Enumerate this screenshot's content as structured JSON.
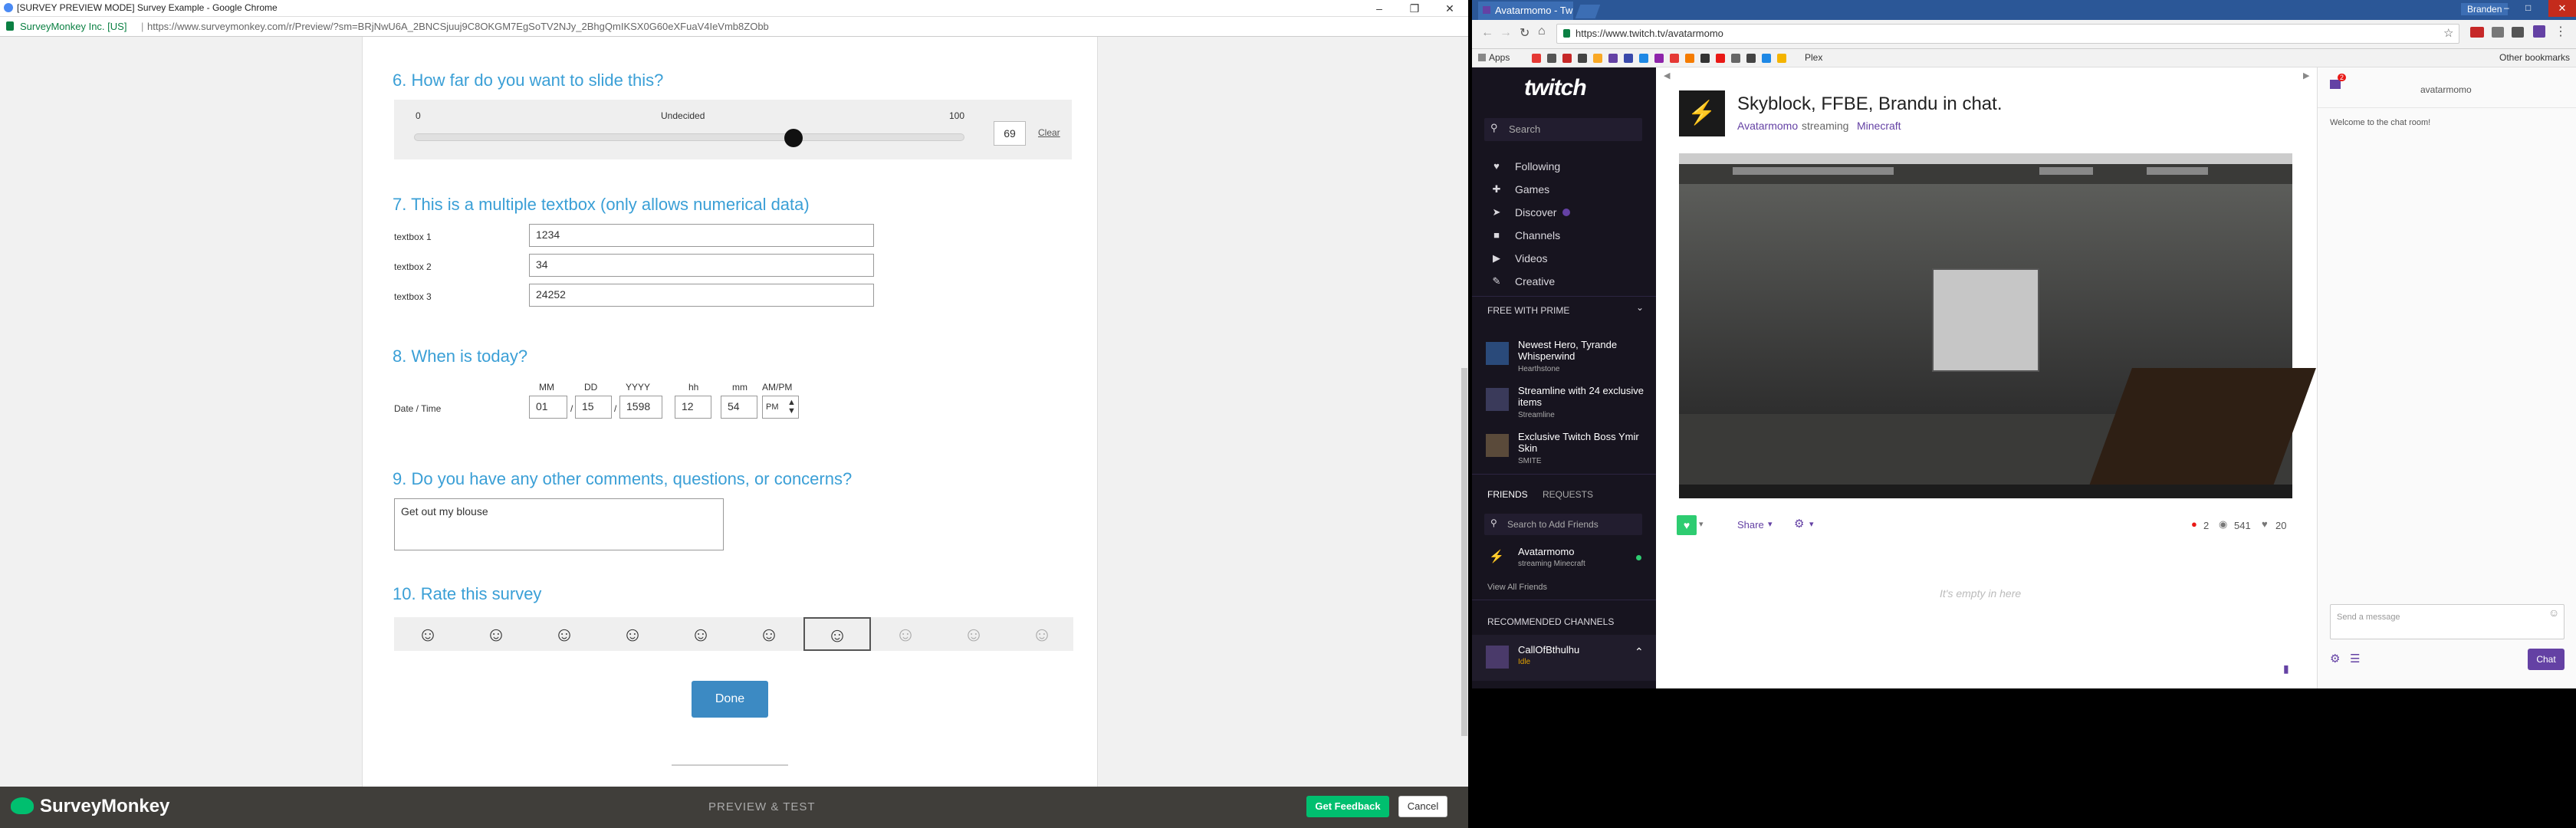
{
  "left_window": {
    "title": "[SURVEY PREVIEW MODE] Survey Example - Google Chrome",
    "url_org": "SurveyMonkey Inc. [US]",
    "url": "https://www.surveymonkey.com/r/Preview/?sm=BRjNwU6A_2BNCSjuuj9C8OKGM7EgSoTV2NJy_2BhgQmIKSX0G60eXFuaV4IeVmb8ZObb",
    "q6": {
      "title": "6. How far do you want to slide this?",
      "min": "0",
      "mid": "Undecided",
      "max": "100",
      "value": "69",
      "value_fraction": 0.69,
      "clear": "Clear"
    },
    "q7": {
      "title": "7. This is a multiple textbox (only allows numerical data)",
      "rows": [
        {
          "label": "textbox 1",
          "value": "1234"
        },
        {
          "label": "textbox 2",
          "value": "34"
        },
        {
          "label": "textbox 3",
          "value": "24252"
        }
      ]
    },
    "q8": {
      "title": "8. When is today?",
      "row_label": "Date / Time",
      "headers": [
        "MM",
        "DD",
        "YYYY",
        "hh",
        "mm",
        "AM/PM"
      ],
      "values": [
        "01",
        "15",
        "1598",
        "12",
        "54",
        "PM"
      ],
      "sep": "/"
    },
    "q9": {
      "title": "9. Do you have any other comments, questions, or concerns?",
      "value": "Get out my blouse"
    },
    "q10": {
      "title": "10. Rate this survey",
      "face": "☺",
      "selected_index": 6
    },
    "done_label": "Done",
    "footer": {
      "brand": "SurveyMonkey",
      "center": "PREVIEW & TEST",
      "feedback": "Get Feedback",
      "cancel": "Cancel"
    }
  },
  "right_window": {
    "tab_title": "Avatarmomo - Twitch",
    "url": "https://www.twitch.tv/avatarmomo",
    "user": "Branden",
    "bookmarks": {
      "apps": "Apps",
      "plex": "Plex",
      "other": "Other bookmarks"
    },
    "nav": {
      "logo": "twitch",
      "search_placeholder": "Search",
      "items": [
        "Following",
        "Games",
        "Discover",
        "Channels",
        "Videos",
        "Creative"
      ]
    },
    "prime": {
      "header": "FREE WITH PRIME",
      "offers": [
        {
          "title": "Newest Hero, Tyrande Whisperwind",
          "sub": "Hearthstone"
        },
        {
          "title": "Streamline with 24 exclusive items",
          "sub": "Streamline"
        },
        {
          "title": "Exclusive Twitch Boss Ymir Skin",
          "sub": "SMITE"
        }
      ]
    },
    "friends": {
      "tab1": "FRIENDS",
      "tab2": "REQUESTS",
      "search_placeholder": "Search to Add Friends",
      "friend_name": "Avatarmomo",
      "friend_status": "streaming Minecraft",
      "view_all": "View All Friends"
    },
    "recommended": {
      "header": "RECOMMENDED CHANNELS",
      "name": "CallOfBthulhu",
      "status": "Idle"
    },
    "stream": {
      "title": "Skyblock, FFBE, Brandu in chat.",
      "channel": "Avatarmomo",
      "streaming_word": "streaming",
      "game": "Minecraft",
      "share": "Share",
      "viewers": "2",
      "views": "541",
      "followers": "20",
      "empty": "It's empty in here"
    },
    "chat": {
      "header": "avatarmomo",
      "notif_count": "2",
      "welcome": "Welcome to the chat room!",
      "placeholder": "Send a message",
      "send": "Chat"
    },
    "colors": {
      "twitch_purple": "#6441a4",
      "survey_blue": "#3a9fd6",
      "sm_green": "#00bf6f"
    }
  }
}
